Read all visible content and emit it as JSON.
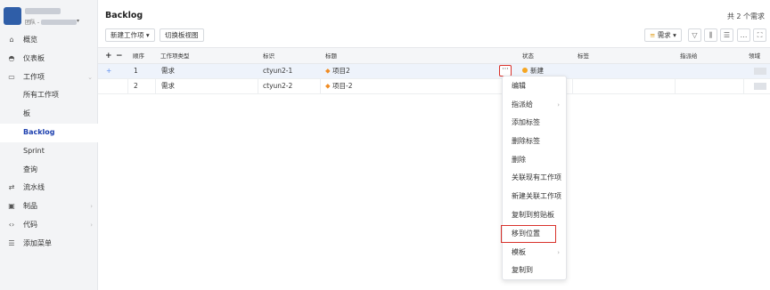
{
  "sidebar": {
    "team_label": "团队 -",
    "items": [
      {
        "label": "概览",
        "icon": "home-icon"
      },
      {
        "label": "仪表板",
        "icon": "dashboard-icon"
      },
      {
        "label": "工作项",
        "icon": "workitem-icon"
      },
      {
        "label": "所有工作项"
      },
      {
        "label": "板"
      },
      {
        "label": "Backlog"
      },
      {
        "label": "Sprint"
      },
      {
        "label": "查询"
      },
      {
        "label": "流水线",
        "icon": "pipeline-icon"
      },
      {
        "label": "制品",
        "icon": "artifact-icon"
      },
      {
        "label": "代码",
        "icon": "code-icon"
      },
      {
        "label": "添加菜单",
        "icon": "menu-icon"
      }
    ]
  },
  "header": {
    "title": "Backlog",
    "count_text": "共 2 个需求"
  },
  "toolbar": {
    "new_workitem_label": "新建工作项 ▾",
    "switch_board_label": "切换板视图",
    "filter_label": "需求 ▾"
  },
  "table": {
    "columns": [
      "顺序",
      "工作项类型",
      "标识",
      "标题",
      "状态",
      "标签",
      "指派给",
      "领域"
    ],
    "rows": [
      {
        "order": "1",
        "type": "需求",
        "id": "ctyun2-1",
        "title": "项目2",
        "status": "新建"
      },
      {
        "order": "2",
        "type": "需求",
        "id": "ctyun2-2",
        "title": "项目-2",
        "status": ""
      }
    ]
  },
  "context_menu": {
    "items": [
      "编辑",
      "指派给",
      "添加标签",
      "删除标签",
      "删除",
      "关联现有工作项",
      "新建关联工作项",
      "复制到剪贴板",
      "移到位置",
      "模板",
      "复制到"
    ]
  },
  "colors": {
    "accent": "#1e40af",
    "highlight_border": "#d9322b",
    "status_new": "#f5a623"
  }
}
